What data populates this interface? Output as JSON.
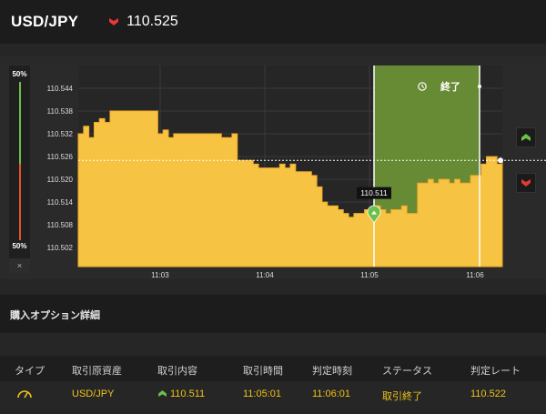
{
  "header": {
    "pair": "USD/JPY",
    "rate": "110.525",
    "direction_icon": "down-arrow-icon",
    "direction_color": "#e53935"
  },
  "gauge": {
    "top_label": "50%",
    "bottom_label": "50%",
    "close_symbol": "×",
    "up_color": "#6cc04a",
    "down_color": "#e0572a"
  },
  "chart_data": {
    "type": "area",
    "y_ticks": [
      "110.544",
      "110.538",
      "110.532",
      "110.526",
      "110.520",
      "110.514",
      "110.508",
      "110.502"
    ],
    "ylim": [
      110.497,
      110.55
    ],
    "x_ticks": [
      "11:03",
      "11:04",
      "11:05",
      "11:06"
    ],
    "series": [
      {
        "values": [
          110.532,
          110.534,
          110.531,
          110.535,
          110.536,
          110.535,
          110.538,
          110.538,
          110.538,
          110.538,
          110.538,
          110.538,
          110.538,
          110.538,
          110.538,
          110.532,
          110.533,
          110.531,
          110.532,
          110.532,
          110.532,
          110.532,
          110.532,
          110.532,
          110.532,
          110.532,
          110.532,
          110.531,
          110.531,
          110.532,
          110.525,
          110.525,
          110.525,
          110.524,
          110.523,
          110.523,
          110.523,
          110.523,
          110.524,
          110.523,
          110.524,
          110.522,
          110.522,
          110.522,
          110.521,
          110.518,
          110.514,
          110.513,
          110.513,
          110.512,
          110.511,
          110.51,
          110.511,
          110.511,
          110.512,
          110.512,
          110.513,
          110.512,
          110.511,
          110.512,
          110.512,
          110.513,
          110.511,
          110.511,
          110.519,
          110.519,
          110.52,
          110.519,
          110.52,
          110.52,
          110.519,
          110.52,
          110.519,
          110.519,
          110.521,
          110.521,
          110.524,
          110.526,
          110.526,
          110.524,
          110.525
        ]
      }
    ],
    "current_rate": 110.525,
    "entry_label": "110.511",
    "expiry_button": "終了",
    "colors": {
      "area": "#f6c342",
      "area_stroke": "#f2a92a",
      "expiry_zone": "#6a8f35",
      "grid": "#3a3a3a"
    }
  },
  "side_buttons": {
    "up_icon": "up-arrow-icon",
    "down_icon": "down-arrow-icon",
    "up_color": "#6cc04a",
    "down_color": "#e53935"
  },
  "details": {
    "title": "購入オプション詳細",
    "columns": [
      "タイプ",
      "取引原資産",
      "取引内容",
      "取引時間",
      "判定時刻",
      "ステータス",
      "判定レート"
    ],
    "row": {
      "type_icon": "gauge-icon",
      "asset": "USD/JPY",
      "trade_icon": "up-arrow-icon",
      "trade": "110.511",
      "trade_time": "11:05:01",
      "judge_time": "11:06:01",
      "status": "取引終了",
      "judge_rate": "110.522"
    }
  }
}
